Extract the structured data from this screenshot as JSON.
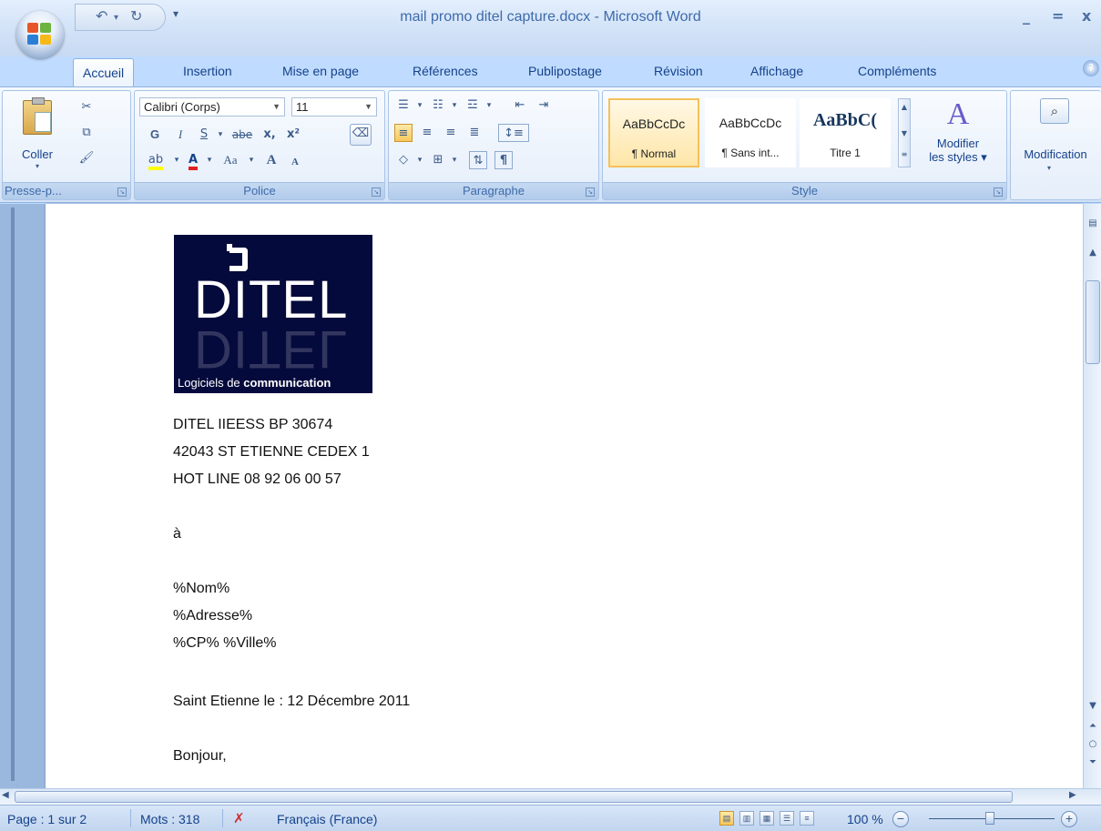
{
  "window": {
    "title": "mail promo ditel capture.docx - Microsoft Word",
    "minimize": "_",
    "maximize": "=",
    "close": "x"
  },
  "tabs": [
    {
      "label": "Accueil"
    },
    {
      "label": "Insertion"
    },
    {
      "label": "Mise en page"
    },
    {
      "label": "Références"
    },
    {
      "label": "Publipostage"
    },
    {
      "label": "Révision"
    },
    {
      "label": "Affichage"
    },
    {
      "label": "Compléments"
    }
  ],
  "ribbon": {
    "clipboard": {
      "paste_label": "Coller",
      "group_label": "Presse-p..."
    },
    "font": {
      "font_name": "Calibri (Corps)",
      "font_size": "11",
      "bold": "G",
      "italic": "I",
      "underline": "S",
      "strike": "abe",
      "subscript": "x,",
      "superscript": "x²",
      "clear": "Aa",
      "grow": "A",
      "shrink": "A",
      "group_label": "Police"
    },
    "paragraph": {
      "group_label": "Paragraphe",
      "pilcrow": "¶"
    },
    "styles": {
      "items": [
        {
          "sample": "AaBbCcDc",
          "name": "¶ Normal"
        },
        {
          "sample": "AaBbCcDc",
          "name": "¶ Sans int..."
        },
        {
          "sample": "AaBbC(",
          "name": "Titre 1"
        }
      ],
      "change_styles_line1": "Modifier",
      "change_styles_line2": "les styles",
      "group_label": "Style"
    },
    "editing": {
      "label": "Modification"
    }
  },
  "document": {
    "logo": {
      "word": "DITEL",
      "tag_plain": "Logiciels de ",
      "tag_bold": "communication"
    },
    "lines": [
      "DITEL IIEESS BP 30674",
      "42043  ST ETIENNE CEDEX 1",
      "HOT LINE 08 92 06 00 57",
      "à",
      "%Nom%",
      "%Adresse%",
      "%CP% %Ville%",
      "Saint Etienne le : 12 Décembre 2011",
      "Bonjour,"
    ]
  },
  "statusbar": {
    "page": "Page : 1 sur 2",
    "words": "Mots : 318",
    "language": "Français (France)",
    "zoom": "100 %",
    "zoom_level_percent": 100
  },
  "colors": {
    "accent": "#15428b",
    "ribbon_bg": "#e3edfa",
    "logo_bg": "#050a3c",
    "selected_style": "#f5c15a"
  }
}
